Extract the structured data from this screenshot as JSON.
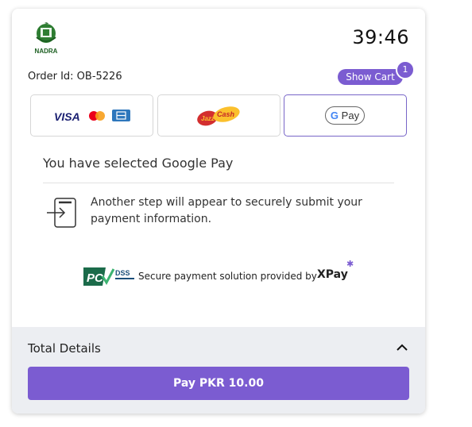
{
  "header": {
    "logo_text": "NADRA",
    "timer": "39:46",
    "order_id": "Order Id: OB-5226",
    "show_cart_label": "Show Cart",
    "cart_count": "1"
  },
  "payment_methods": {
    "card": {
      "visa_text": "VISA",
      "icons": [
        "visa-icon",
        "mastercard-icon",
        "amex-icon"
      ]
    },
    "jazzcash": {
      "text": "JazzCash",
      "icon": "jazzcash-logo"
    },
    "gpay": {
      "g_text": "G",
      "pay_text": "Pay",
      "selected": true
    }
  },
  "selection": {
    "title": "You have selected Google Pay",
    "info_text": "Another step will appear to securely submit your payment information.",
    "icon": "login-icon"
  },
  "secure": {
    "pci_text": "DSS",
    "text": "Secure payment solution provided by",
    "brand": "XPay"
  },
  "footer": {
    "total_label": "Total Details",
    "pay_label": "Pay PKR 10.00"
  },
  "colors": {
    "accent": "#7b5cd1",
    "panel_bg": "#eceef2"
  }
}
